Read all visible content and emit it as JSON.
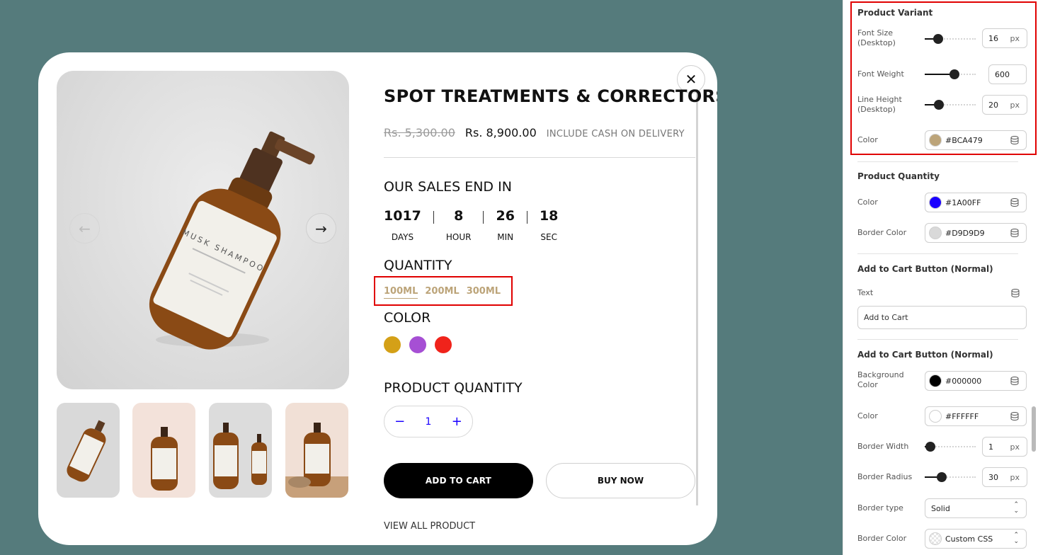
{
  "product": {
    "title": "SPOT TREATMENTS & CORRECTORS",
    "old_price": "Rs. 5,300.00",
    "new_price": "Rs. 8,900.00",
    "cod_note": "INCLUDE CASH ON DELIVERY",
    "sales_heading": "OUR SALES END IN",
    "countdown": [
      {
        "value": "1017",
        "label": "DAYS"
      },
      {
        "value": "8",
        "label": "HOUR"
      },
      {
        "value": "26",
        "label": "MIN"
      },
      {
        "value": "18",
        "label": "SEC"
      }
    ],
    "quantity_heading": "QUANTITY",
    "variants": [
      "100ML",
      "200ML",
      "300ML"
    ],
    "color_heading": "COLOR",
    "colors": [
      "#d4a017",
      "#a64fd4",
      "#f0231b"
    ],
    "product_quantity_heading": "PRODUCT QUANTITY",
    "quantity_value": "1",
    "minus": "−",
    "plus": "+",
    "add_to_cart": "ADD TO CART",
    "buy_now": "BUY NOW",
    "view_all": "VIEW ALL PRODUCT",
    "close": "✕",
    "prev": "←",
    "next": "→",
    "bottle_label": "MUSK SHAMPOO"
  },
  "panel": {
    "variant_section": {
      "title": "Product Variant",
      "font_size_label": "Font Size (Desktop)",
      "font_size_value": "16",
      "font_weight_label": "Font Weight",
      "font_weight_value": "600",
      "line_height_label": "Line Height (Desktop)",
      "line_height_value": "20",
      "unit": "px",
      "color_label": "Color",
      "color_value": "#BCA479"
    },
    "quantity_section": {
      "title": "Product Quantity",
      "color_label": "Color",
      "color_value": "#1A00FF",
      "border_color_label": "Border Color",
      "border_color_value": "#D9D9D9"
    },
    "cart_text_section": {
      "title": "Add to Cart Button (Normal)",
      "text_label": "Text",
      "text_value": "Add to Cart"
    },
    "cart_style_section": {
      "title": "Add to Cart Button (Normal)",
      "bg_label": "Background Color",
      "bg_value": "#000000",
      "color_label": "Color",
      "color_value": "#FFFFFF",
      "border_width_label": "Border Width",
      "border_width_value": "1",
      "border_radius_label": "Border Radius",
      "border_radius_value": "30",
      "border_type_label": "Border type",
      "border_type_value": "Solid",
      "border_color_label": "Border Color",
      "border_color_value": "Custom CSS"
    }
  },
  "colors": {
    "background": "#557b7c",
    "accent_gold": "#BCA479",
    "qty_blue": "#1A00FF",
    "highlight_red": "#e00000"
  },
  "slider_levels": {
    "font_size": 0.2,
    "font_weight": 0.6,
    "line_height": 0.22,
    "border_width": 0.02,
    "border_radius": 0.3
  }
}
